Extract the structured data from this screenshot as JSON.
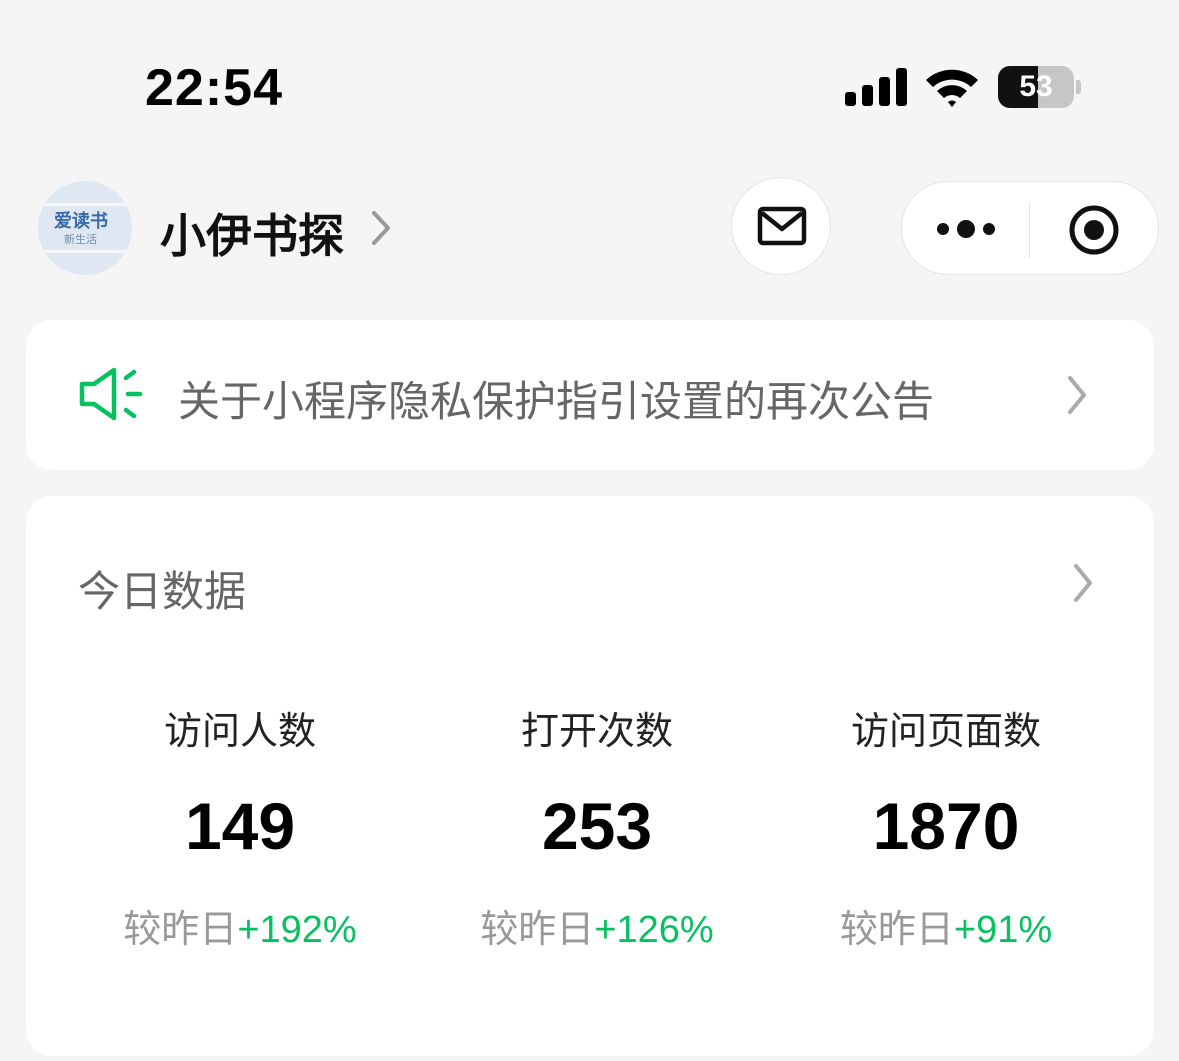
{
  "status_bar": {
    "time": "22:54",
    "battery_level": "53",
    "battery_fraction": 0.53,
    "icons": [
      "signal-icon",
      "wifi-icon",
      "battery-icon"
    ]
  },
  "header": {
    "avatar_text": "爱读书",
    "avatar_subtext": "新生活",
    "app_name": "小伊书探",
    "icons": [
      "chevron-right-icon",
      "mail-icon",
      "more-icon",
      "target-icon"
    ]
  },
  "notice": {
    "text": "关于小程序隐私保护指引设置的再次公告",
    "icon": "speaker-icon",
    "accent_color": "#07c160"
  },
  "today_data": {
    "title": "今日数据",
    "compare_label": "较昨日",
    "metrics": [
      {
        "label": "访问人数",
        "value": "149",
        "change": "+192%"
      },
      {
        "label": "打开次数",
        "value": "253",
        "change": "+126%"
      },
      {
        "label": "访问页面数",
        "value": "1870",
        "change": "+91%"
      }
    ]
  },
  "colors": {
    "background": "#f5f5f5",
    "card": "#ffffff",
    "positive": "#07c160",
    "muted_text": "#999999"
  }
}
